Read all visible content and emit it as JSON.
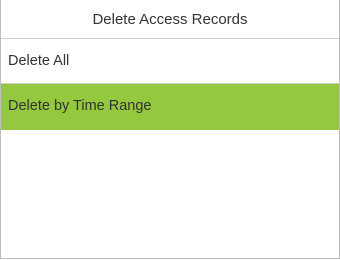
{
  "header": {
    "title": "Delete Access Records"
  },
  "menu": {
    "items": [
      {
        "label": "Delete All",
        "selected": false
      },
      {
        "label": "Delete by Time Range",
        "selected": true
      }
    ]
  },
  "colors": {
    "selected_background": "#94c83e",
    "divider": "#cfcfcf",
    "text": "#333333",
    "background": "#ffffff"
  }
}
